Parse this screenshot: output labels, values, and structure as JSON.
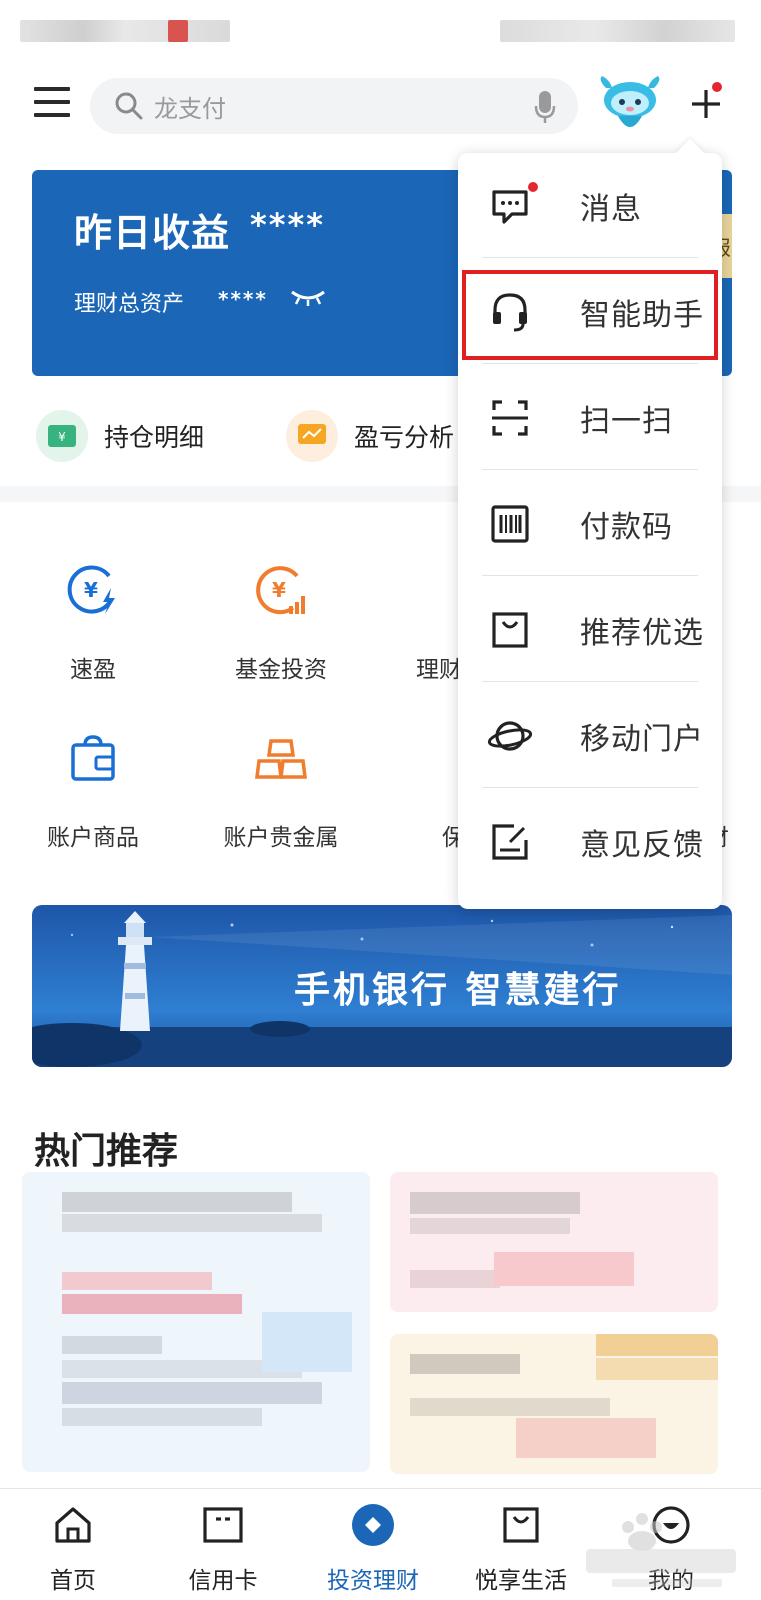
{
  "search": {
    "placeholder": "龙支付"
  },
  "earnings": {
    "title": "昨日收益",
    "masked_value": "****",
    "asset_label": "理财总资产",
    "asset_masked": "****",
    "side_tab": "报"
  },
  "quick_links": [
    {
      "label": "持仓明细",
      "icon": "holdings-icon"
    },
    {
      "label": "盈亏分析",
      "icon": "profit-chart-icon"
    }
  ],
  "grid": [
    {
      "label": "速盈",
      "icon": "yuan-lightning-icon"
    },
    {
      "label": "基金投资",
      "icon": "yuan-chart-icon"
    },
    {
      "label": "理财",
      "icon": "finance-icon"
    },
    {
      "label": "账户商品",
      "icon": "wallet-bag-icon"
    },
    {
      "label": "账户贵金属",
      "icon": "gold-bars-icon"
    },
    {
      "label": "保",
      "icon": "insurance-icon"
    },
    {
      "label": "财",
      "icon": "wealth-icon"
    }
  ],
  "banner": {
    "text": "手机银行  智慧建行"
  },
  "section": {
    "title": "热门推荐"
  },
  "bottom_nav": [
    {
      "label": "首页",
      "icon": "home-icon",
      "active": false
    },
    {
      "label": "信用卡",
      "icon": "credit-card-icon",
      "active": false
    },
    {
      "label": "投资理财",
      "icon": "invest-icon",
      "active": true
    },
    {
      "label": "悦享生活",
      "icon": "shopping-bag-icon",
      "active": false
    },
    {
      "label": "我的",
      "icon": "profile-icon",
      "active": false
    }
  ],
  "menu": {
    "items": [
      {
        "label": "消息",
        "icon": "message-icon",
        "badge": true
      },
      {
        "label": "智能助手",
        "icon": "headset-icon",
        "highlighted": true
      },
      {
        "label": "扫一扫",
        "icon": "scan-icon"
      },
      {
        "label": "付款码",
        "icon": "barcode-icon"
      },
      {
        "label": "推荐优选",
        "icon": "shopping-bag-icon"
      },
      {
        "label": "移动门户",
        "icon": "planet-icon"
      },
      {
        "label": "意见反馈",
        "icon": "feedback-icon"
      }
    ]
  },
  "colors": {
    "brand_blue": "#1b66b7",
    "accent_orange": "#f07c2e",
    "highlight_red": "#e02020",
    "badge_red": "#e5262f"
  }
}
